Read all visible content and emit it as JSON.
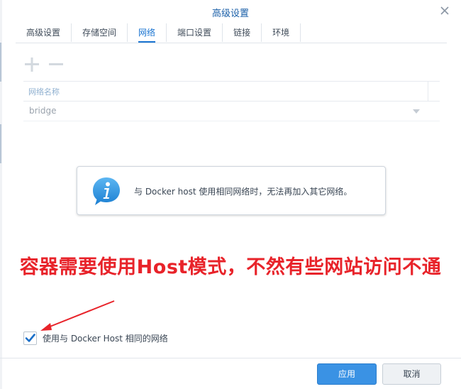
{
  "window": {
    "title": "高级设置"
  },
  "tabs": [
    {
      "label": "高级设置"
    },
    {
      "label": "存储空间"
    },
    {
      "label": "网络",
      "active": true
    },
    {
      "label": "端口设置"
    },
    {
      "label": "链接"
    },
    {
      "label": "环境"
    }
  ],
  "toolbar": {
    "add_icon": "plus-icon",
    "remove_icon": "minus-icon"
  },
  "grid": {
    "column_header": "网络名称",
    "rows": [
      {
        "name": "bridge"
      }
    ]
  },
  "info": {
    "icon": "info-icon",
    "message": "与 Docker host 使用相同网络时，无法再加入其它网络。"
  },
  "annotation": {
    "text": "容器需要使用Host模式，不然有些网站访问不通",
    "color": "#e8232a"
  },
  "options": {
    "use_host_network_label": "使用与 Docker Host 相同的网络",
    "use_host_network_checked": true
  },
  "buttons": {
    "apply": "应用",
    "cancel": "取消"
  },
  "colors": {
    "accent": "#1a74d1",
    "primary_button": "#3a92e4",
    "title": "#1a5fa8"
  }
}
